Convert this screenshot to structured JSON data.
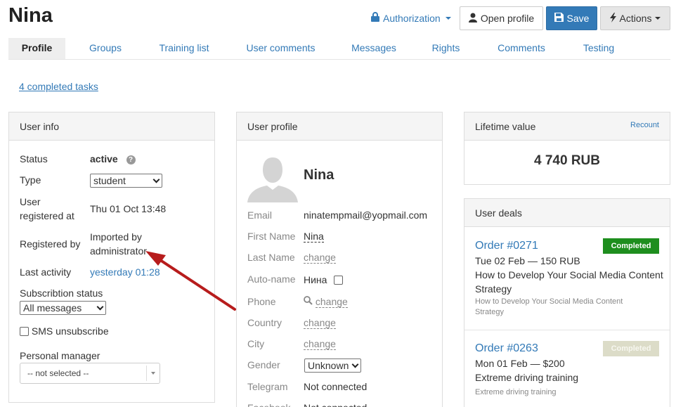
{
  "header": {
    "title": "Nina",
    "authorization_label": "Authorization",
    "open_profile_label": "Open profile",
    "save_label": "Save",
    "actions_label": "Actions"
  },
  "tabs": [
    {
      "label": "Profile",
      "active": true
    },
    {
      "label": "Groups"
    },
    {
      "label": "Training list"
    },
    {
      "label": "User comments"
    },
    {
      "label": "Messages"
    },
    {
      "label": "Rights"
    },
    {
      "label": "Comments"
    },
    {
      "label": "Testing"
    }
  ],
  "completed_tasks_link": "4 completed tasks",
  "user_info": {
    "title": "User info",
    "status_label": "Status",
    "status_value": "active",
    "type_label": "Type",
    "type_value": "student",
    "registered_label_1": "User",
    "registered_label_2": "registered at",
    "registered_value": "Thu 01 Oct 13:48",
    "registered_by_label": "Registered by",
    "registered_by_value_1": "Imported by",
    "registered_by_value_2": "administrator",
    "last_activity_label": "Last activity",
    "last_activity_value": "yesterday 01:28",
    "subscription_label": "Subscribtion status",
    "subscription_value": "All messages",
    "sms_label": "SMS unsubscribe",
    "manager_label": "Personal manager",
    "manager_value": "-- not selected --"
  },
  "user_profile": {
    "title": "User profile",
    "name": "Nina",
    "email_label": "Email",
    "email_value": "ninatempmail@yopmail.com",
    "first_name_label": "First Name",
    "first_name_value": "Nina",
    "last_name_label": "Last Name",
    "last_name_value": "change",
    "auto_name_label": "Auto-name",
    "auto_name_value": "Нина",
    "phone_label": "Phone",
    "phone_value": "change",
    "country_label": "Country",
    "country_value": "change",
    "city_label": "City",
    "city_value": "change",
    "gender_label": "Gender",
    "gender_value": "Unknown",
    "telegram_label": "Telegram",
    "telegram_value": "Not connected",
    "facebook_label": "Facebook",
    "facebook_value": "Not connected"
  },
  "lifetime": {
    "title": "Lifetime value",
    "recount_label": "Recount",
    "value": "4 740 RUB"
  },
  "deals": {
    "title": "User deals",
    "items": [
      {
        "order": "Order #0271",
        "status": "Completed",
        "status_color": "#1e8e1e",
        "date_price": "Tue 02 Feb — 150 RUB",
        "product_1": "How to Develop Your Social Media Content",
        "product_2": "Strategy",
        "small_1": "How to Develop Your Social Media Content",
        "small_2": "Strategy"
      },
      {
        "order": "Order #0263",
        "status": "Completed",
        "status_color": "#dcdcc8",
        "date_price": "Mon 01 Feb — $200",
        "product_1": "Extreme driving training",
        "small_1": "Extreme driving training"
      }
    ]
  },
  "colors": {
    "link": "#337ab7",
    "save_button": "#337ab7",
    "annotation_arrow": "#b71c1c"
  },
  "icons": [
    "lock-icon",
    "user-icon",
    "floppy-disk-icon",
    "bolt-icon",
    "help-icon",
    "search-icon",
    "avatar-placeholder-icon"
  ]
}
